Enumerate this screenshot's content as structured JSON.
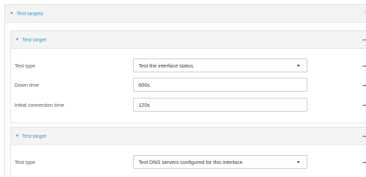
{
  "outer": {
    "title": "Test targets"
  },
  "targets": [
    {
      "title": "Test target",
      "rows": [
        {
          "label": "Test type",
          "value": "Test the interface status.",
          "kind": "select"
        },
        {
          "label": "Down time",
          "value": "600s",
          "kind": "input"
        },
        {
          "label": "Initial connection time",
          "value": "120s",
          "kind": "input"
        }
      ]
    },
    {
      "title": "Test target",
      "rows": [
        {
          "label": "Test type",
          "value": "Test DNS servers configured for this interface",
          "kind": "select"
        }
      ]
    }
  ],
  "icons": {
    "caret": "caret-down-icon",
    "more": "more-options-icon"
  },
  "colors": {
    "accent": "#2e9ad0",
    "header_bg": "#f3f3f3",
    "border": "#e1e1e1"
  }
}
